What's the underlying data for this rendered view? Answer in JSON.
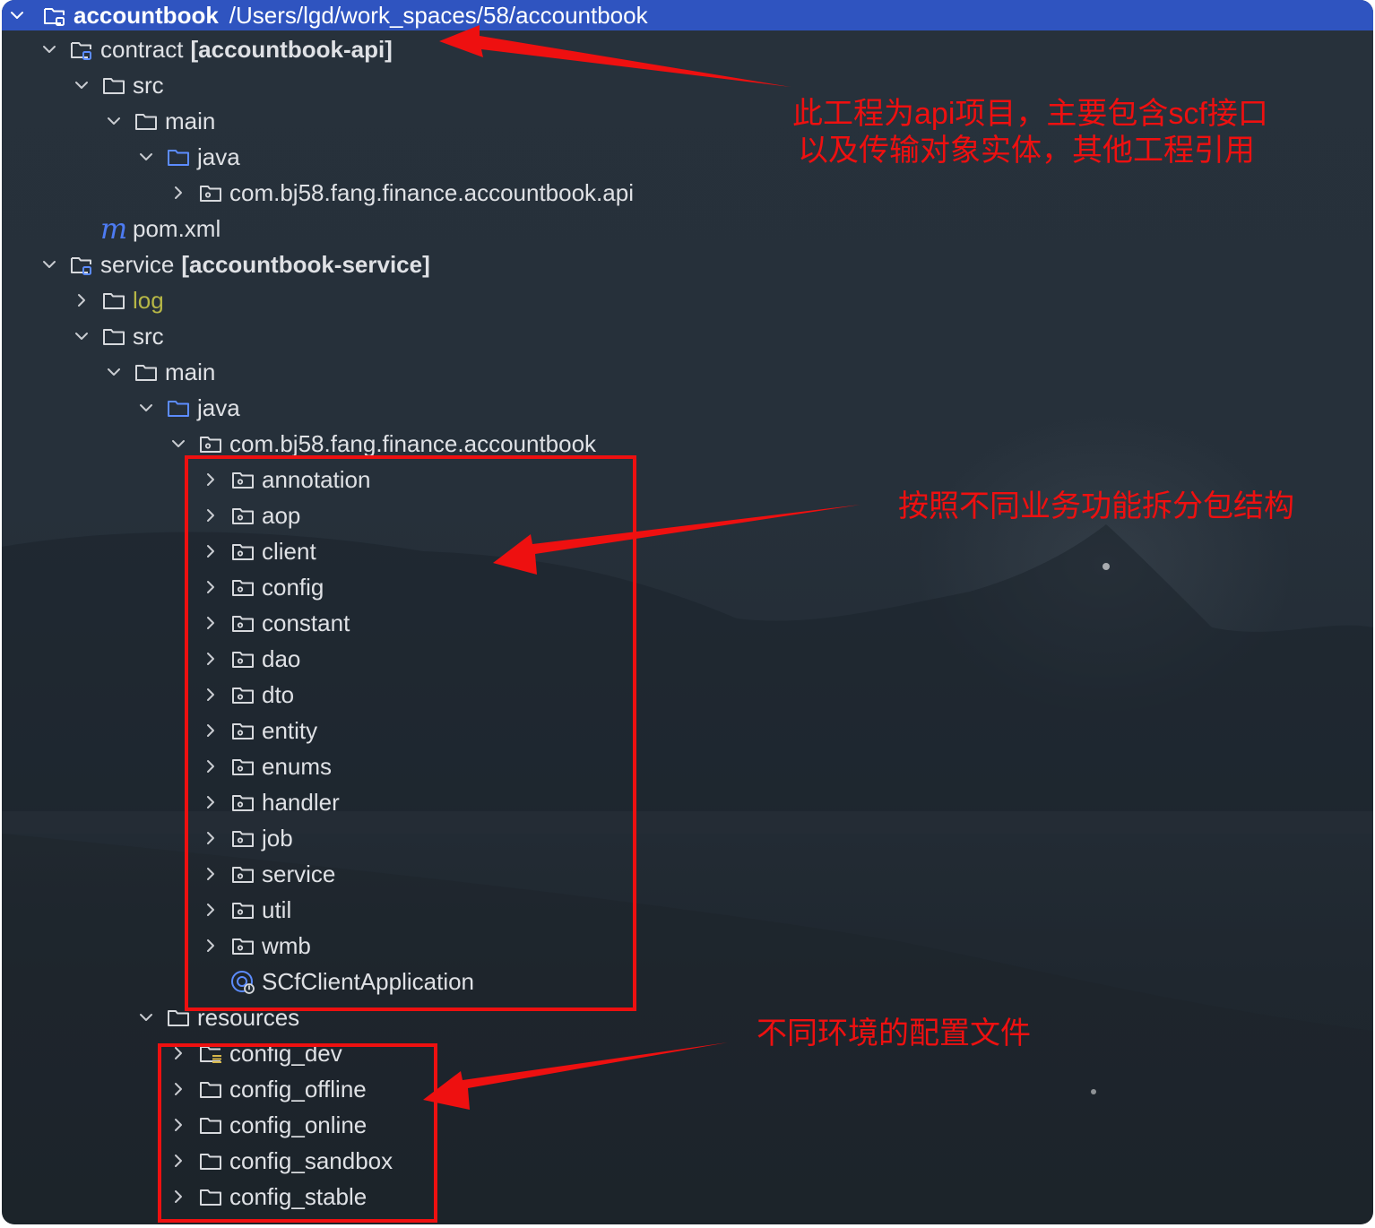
{
  "root": {
    "name": "accountbook",
    "path": "/Users/lgd/work_spaces/58/accountbook"
  },
  "tree": [
    {
      "id": "contract",
      "depth": 1,
      "chevron": "down",
      "icon": "module-folder-icon",
      "name": "contract",
      "suffix": "[accountbook-api]"
    },
    {
      "id": "contract-src",
      "depth": 2,
      "chevron": "down",
      "icon": "folder-icon",
      "name": "src"
    },
    {
      "id": "contract-main",
      "depth": 3,
      "chevron": "down",
      "icon": "folder-icon",
      "name": "main"
    },
    {
      "id": "contract-java",
      "depth": 4,
      "chevron": "down",
      "icon": "source-folder-icon",
      "name": "java"
    },
    {
      "id": "contract-package",
      "depth": 5,
      "chevron": "right",
      "icon": "package-icon",
      "name": "com.bj58.fang.finance.accountbook.api"
    },
    {
      "id": "contract-pom",
      "depth": 2,
      "chevron": "none",
      "icon": "maven-icon",
      "icon_text": "m",
      "name": "pom.xml"
    },
    {
      "id": "service",
      "depth": 1,
      "chevron": "down",
      "icon": "module-folder-icon",
      "name": "service",
      "suffix": "[accountbook-service]"
    },
    {
      "id": "service-log",
      "depth": 2,
      "chevron": "right",
      "icon": "folder-icon",
      "name": "log",
      "excluded": true
    },
    {
      "id": "service-src",
      "depth": 2,
      "chevron": "down",
      "icon": "folder-icon",
      "name": "src"
    },
    {
      "id": "service-main",
      "depth": 3,
      "chevron": "down",
      "icon": "folder-icon",
      "name": "main"
    },
    {
      "id": "service-java",
      "depth": 4,
      "chevron": "down",
      "icon": "source-folder-icon",
      "name": "java"
    },
    {
      "id": "service-package",
      "depth": 5,
      "chevron": "down",
      "icon": "package-icon",
      "name": "com.bj58.fang.finance.accountbook"
    },
    {
      "id": "pkg-annotation",
      "depth": 6,
      "chevron": "right",
      "icon": "package-icon",
      "name": "annotation"
    },
    {
      "id": "pkg-aop",
      "depth": 6,
      "chevron": "right",
      "icon": "package-icon",
      "name": "aop"
    },
    {
      "id": "pkg-client",
      "depth": 6,
      "chevron": "right",
      "icon": "package-icon",
      "name": "client"
    },
    {
      "id": "pkg-config",
      "depth": 6,
      "chevron": "right",
      "icon": "package-icon",
      "name": "config"
    },
    {
      "id": "pkg-constant",
      "depth": 6,
      "chevron": "right",
      "icon": "package-icon",
      "name": "constant"
    },
    {
      "id": "pkg-dao",
      "depth": 6,
      "chevron": "right",
      "icon": "package-icon",
      "name": "dao"
    },
    {
      "id": "pkg-dto",
      "depth": 6,
      "chevron": "right",
      "icon": "package-icon",
      "name": "dto"
    },
    {
      "id": "pkg-entity",
      "depth": 6,
      "chevron": "right",
      "icon": "package-icon",
      "name": "entity"
    },
    {
      "id": "pkg-enums",
      "depth": 6,
      "chevron": "right",
      "icon": "package-icon",
      "name": "enums"
    },
    {
      "id": "pkg-handler",
      "depth": 6,
      "chevron": "right",
      "icon": "package-icon",
      "name": "handler"
    },
    {
      "id": "pkg-job",
      "depth": 6,
      "chevron": "right",
      "icon": "package-icon",
      "name": "job"
    },
    {
      "id": "pkg-service",
      "depth": 6,
      "chevron": "right",
      "icon": "package-icon",
      "name": "service"
    },
    {
      "id": "pkg-util",
      "depth": 6,
      "chevron": "right",
      "icon": "package-icon",
      "name": "util"
    },
    {
      "id": "pkg-wmb",
      "depth": 6,
      "chevron": "right",
      "icon": "package-icon",
      "name": "wmb"
    },
    {
      "id": "class-scfclientapplication",
      "depth": 6,
      "chevron": "none",
      "icon": "spring-boot-class-icon",
      "name": "SCfClientApplication"
    },
    {
      "id": "resources",
      "depth": 4,
      "chevron": "down",
      "icon": "resources-folder-icon",
      "name": "resources"
    },
    {
      "id": "config-dev",
      "depth": 5,
      "chevron": "right",
      "icon": "resource-folder-icon",
      "name": "config_dev"
    },
    {
      "id": "config-offline",
      "depth": 5,
      "chevron": "right",
      "icon": "folder-icon",
      "name": "config_offline"
    },
    {
      "id": "config-online",
      "depth": 5,
      "chevron": "right",
      "icon": "folder-icon",
      "name": "config_online"
    },
    {
      "id": "config-sandbox",
      "depth": 5,
      "chevron": "right",
      "icon": "folder-icon",
      "name": "config_sandbox"
    },
    {
      "id": "config-stable",
      "depth": 5,
      "chevron": "right",
      "icon": "folder-icon",
      "name": "config_stable"
    },
    {
      "id": "next-item-cut-off",
      "depth": 5,
      "chevron": "right",
      "icon": "folder-icon",
      "name": ""
    }
  ],
  "annotations": {
    "api_note_line1": "此工程为api项目，主要包含scf接口",
    "api_note_line2": "以及传输对象实体，其他工程引用",
    "packages_note": "按照不同业务功能拆分包结构",
    "config_note": "不同环境的配置文件"
  },
  "colors": {
    "selection": "#2f54c0",
    "annotation_red": "#ee1010",
    "excluded_folder": "#b6b646",
    "maven_icon": "#4d7bf3",
    "text": "#dfe1e5"
  }
}
